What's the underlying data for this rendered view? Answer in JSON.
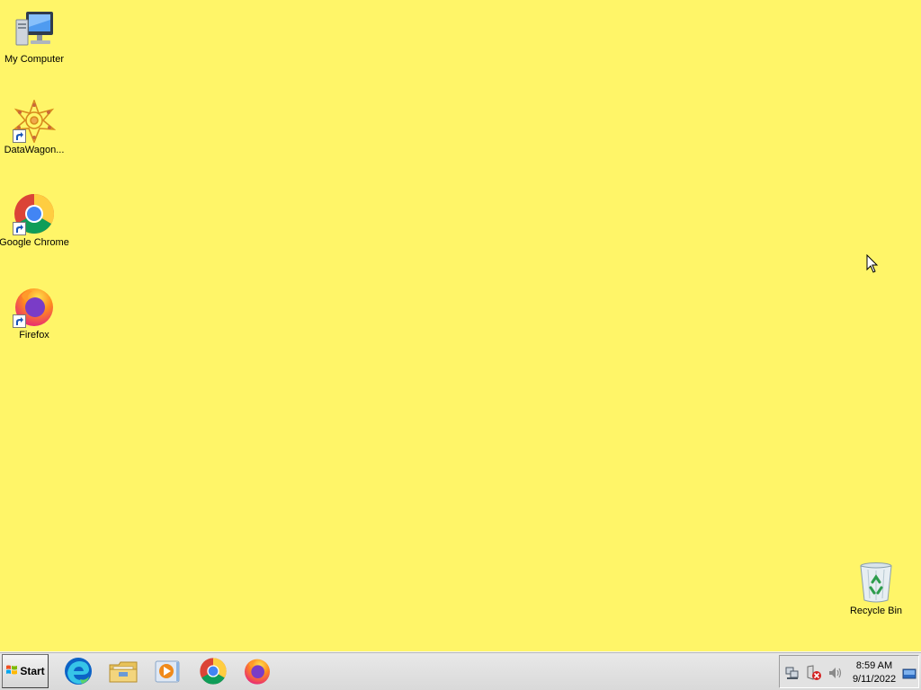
{
  "desktop": {
    "background_color": "#fff568",
    "icons": [
      {
        "label": "My Computer",
        "icon": "my-computer-icon",
        "shortcut": false
      },
      {
        "label": "DataWagon...",
        "icon": "datawagon-icon",
        "shortcut": true
      },
      {
        "label": "Google Chrome",
        "icon": "chrome-icon",
        "shortcut": true
      },
      {
        "label": "Firefox",
        "icon": "firefox-icon",
        "shortcut": true
      },
      {
        "label": "Recycle Bin",
        "icon": "recycle-bin-icon",
        "shortcut": false
      }
    ]
  },
  "taskbar": {
    "start_label": "Start",
    "pinned_apps": [
      {
        "icon": "edge-icon"
      },
      {
        "icon": "file-explorer-icon"
      },
      {
        "icon": "media-player-icon"
      },
      {
        "icon": "chrome-icon"
      },
      {
        "icon": "firefox-icon"
      }
    ],
    "tray": {
      "icons": [
        "network-icon",
        "security-alert-icon",
        "volume-icon",
        "show-desktop-icon"
      ],
      "time": "8:59 AM",
      "date": "9/11/2022"
    }
  }
}
